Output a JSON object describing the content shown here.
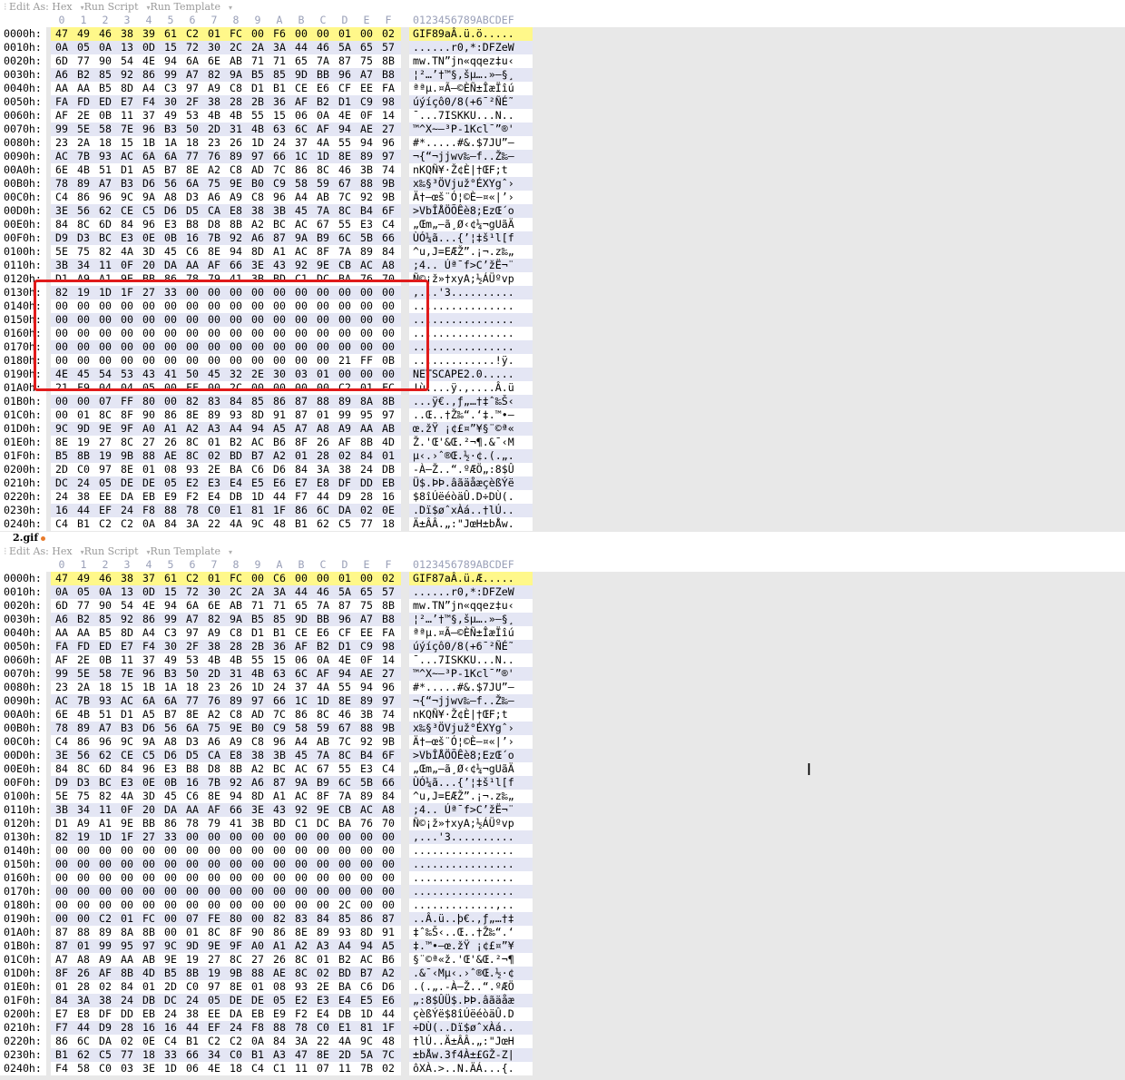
{
  "toolbar": {
    "items": [
      "Edit As: Hex",
      "Run Script",
      "Run Template"
    ]
  },
  "header": {
    "columns": [
      "0",
      "1",
      "2",
      "3",
      "4",
      "5",
      "6",
      "7",
      "8",
      "9",
      "A",
      "B",
      "C",
      "D",
      "E",
      "F"
    ],
    "ascii_header": "0123456789ABCDEF"
  },
  "tab": {
    "label": "2.gif"
  },
  "panes": [
    {
      "rows": [
        {
          "addr": "0000h:",
          "hex": "47 49 46 38 39 61 C2 01 FC 00 F6 00 00 01 00 02",
          "ascii": "GIF89aÂ.ü.ö.....",
          "hl": true
        },
        {
          "addr": "0010h:",
          "hex": "0A 05 0A 13 0D 15 72 30 2C 2A 3A 44 46 5A 65 57",
          "ascii": "......r0,*:DFZeW"
        },
        {
          "addr": "0020h:",
          "hex": "6D 77 90 54 4E 94 6A 6E AB 71 71 65 7A 87 75 8B",
          "ascii": "mw.TN”jn«qqez‡u‹"
        },
        {
          "addr": "0030h:",
          "hex": "A6 B2 85 92 86 99 A7 82 9A B5 85 9D BB 96 A7 B8",
          "ascii": "¦²…’†™§‚šµ….»–§¸"
        },
        {
          "addr": "0040h:",
          "hex": "AA AA B5 8D A4 C3 97 A9 C8 D1 B1 CE E6 CF EE FA",
          "ascii": "ªªµ.¤Ã—©ÈÑ±ÎæÏîú"
        },
        {
          "addr": "0050h:",
          "hex": "FA FD ED E7 F4 30 2F 38 28 2B 36 AF B2 D1 C9 98",
          "ascii": "úýíçô0/8(+6¯²ÑÉ˜"
        },
        {
          "addr": "0060h:",
          "hex": "AF 2E 0B 11 37 49 53 4B 4B 55 15 06 0A 4E 0F 14",
          "ascii": "¯...7ISKKU...N.."
        },
        {
          "addr": "0070h:",
          "hex": "99 5E 58 7E 96 B3 50 2D 31 4B 63 6C AF 94 AE 27",
          "ascii": "™^X~–³P-1Kcl¯”®'"
        },
        {
          "addr": "0080h:",
          "hex": "23 2A 18 15 1B 1A 18 23 26 1D 24 37 4A 55 94 96",
          "ascii": "#*.....#&.$7JU”–"
        },
        {
          "addr": "0090h:",
          "hex": "AC 7B 93 AC 6A 6A 77 76 89 97 66 1C 1D 8E 89 97",
          "ascii": "¬{“¬jjwv‰—f..Ž‰—"
        },
        {
          "addr": "00A0h:",
          "hex": "6E 4B 51 D1 A5 B7 8E A2 C8 AD 7C 86 8C 46 3B 74",
          "ascii": "nKQÑ¥·Ž¢È­|†ŒF;t"
        },
        {
          "addr": "00B0h:",
          "hex": "78 89 A7 B3 D6 56 6A 75 9E B0 C9 58 59 67 88 9B",
          "ascii": "x‰§³ÖVjuž°ÉXYgˆ›"
        },
        {
          "addr": "00C0h:",
          "hex": "C4 86 96 9C 9A A8 D3 A6 A9 C8 96 A4 AB 7C 92 9B",
          "ascii": "Ä†–œš¨Ó¦©È–¤«|’›"
        },
        {
          "addr": "00D0h:",
          "hex": "3E 56 62 CE C5 D6 D5 CA E8 38 3B 45 7A 8C B4 6F",
          "ascii": ">VbÎÅÖÕÊè8;EzŒ´o"
        },
        {
          "addr": "00E0h:",
          "hex": "84 8C 6D 84 96 E3 B8 D8 8B A2 BC AC 67 55 E3 C4",
          "ascii": "„Œm„–ã¸Ø‹¢¼¬gUãÄ"
        },
        {
          "addr": "00F0h:",
          "hex": "D9 D3 BC E3 0E 0B 16 7B 92 A6 87 9A B9 6C 5B 66",
          "ascii": "ÙÓ¼ã...{’¦‡š¹l[f"
        },
        {
          "addr": "0100h:",
          "hex": "5E 75 82 4A 3D 45 C6 8E 94 8D A1 AC 8F 7A 89 84",
          "ascii": "^u‚J=EÆŽ”.¡¬.z‰„"
        },
        {
          "addr": "0110h:",
          "hex": "3B 34 11 0F 20 DA AA AF 66 3E 43 92 9E CB AC A8",
          "ascii": ";4.. Úª¯f>C’žË¬¨"
        },
        {
          "addr": "0120h:",
          "hex": "D1 A9 A1 9E BB 86 78 79 41 3B BD C1 DC BA 76 70",
          "ascii": "Ñ©¡ž»†xyA;½ÁÜºvp"
        },
        {
          "addr": "0130h:",
          "hex": "82 19 1D 1F 27 33 00 00 00 00 00 00 00 00 00 00",
          "ascii": "‚...'3.........."
        },
        {
          "addr": "0140h:",
          "hex": "00 00 00 00 00 00 00 00 00 00 00 00 00 00 00 00",
          "ascii": "................"
        },
        {
          "addr": "0150h:",
          "hex": "00 00 00 00 00 00 00 00 00 00 00 00 00 00 00 00",
          "ascii": "................"
        },
        {
          "addr": "0160h:",
          "hex": "00 00 00 00 00 00 00 00 00 00 00 00 00 00 00 00",
          "ascii": "................"
        },
        {
          "addr": "0170h:",
          "hex": "00 00 00 00 00 00 00 00 00 00 00 00 00 00 00 00",
          "ascii": "................"
        },
        {
          "addr": "0180h:",
          "hex": "00 00 00 00 00 00 00 00 00 00 00 00 00 21 FF 0B",
          "ascii": ".............!ÿ."
        },
        {
          "addr": "0190h:",
          "hex": "4E 45 54 53 43 41 50 45 32 2E 30 03 01 00 00 00",
          "ascii": "NETSCAPE2.0....."
        },
        {
          "addr": "01A0h:",
          "hex": "21 F9 04 04 05 00 FF 00 2C 00 00 00 00 C2 01 FC",
          "ascii": "!ù....ÿ.,....Â.ü"
        },
        {
          "addr": "01B0h:",
          "hex": "00 00 07 FF 80 00 82 83 84 85 86 87 88 89 8A 8B",
          "ascii": "...ÿ€.‚ƒ„…†‡ˆ‰Š‹"
        },
        {
          "addr": "01C0h:",
          "hex": "00 01 8C 8F 90 86 8E 89 93 8D 91 87 01 99 95 97",
          "ascii": "..Œ..†Ž‰“.‘‡.™•—"
        },
        {
          "addr": "01D0h:",
          "hex": "9C 9D 9E 9F A0 A1 A2 A3 A4 94 A5 A7 A8 A9 AA AB",
          "ascii": "œ.žŸ ¡¢£¤”¥§¨©ª«"
        },
        {
          "addr": "01E0h:",
          "hex": "8E 19 27 8C 27 26 8C 01 B2 AC B6 8F 26 AF 8B 4D",
          "ascii": "Ž.'Œ'&Œ.²¬¶.&¯‹M"
        },
        {
          "addr": "01F0h:",
          "hex": "B5 8B 19 9B 88 AE 8C 02 BD B7 A2 01 28 02 84 01",
          "ascii": "µ‹.›ˆ®Œ.½·¢.(.„."
        },
        {
          "addr": "0200h:",
          "hex": "2D C0 97 8E 01 08 93 2E BA C6 D6 84 3A 38 24 DB",
          "ascii": "-À—Ž..“.ºÆÖ„:8$Û"
        },
        {
          "addr": "0210h:",
          "hex": "DC 24 05 DE DE 05 E2 E3 E4 E5 E6 E7 E8 DF DD EB",
          "ascii": "Ü$.ÞÞ.âãäåæçèßÝë"
        },
        {
          "addr": "0220h:",
          "hex": "24 38 EE DA EB E9 F2 E4 DB 1D 44 F7 44 D9 28 16",
          "ascii": "$8îÚëéòäÛ.D÷DÙ(."
        },
        {
          "addr": "0230h:",
          "hex": "16 44 EF 24 F8 88 78 C0 E1 81 1F 86 6C DA 02 0E",
          "ascii": ".Dï$øˆxÀá..†lÚ.."
        },
        {
          "addr": "0240h:",
          "hex": "C4 B1 C2 C2 0A 84 3A 22 4A 9C 48 B1 62 C5 77 18",
          "ascii": "Ä±ÂÂ.„:\"JœH±bÅw."
        }
      ]
    },
    {
      "rows": [
        {
          "addr": "0000h:",
          "hex": "47 49 46 38 37 61 C2 01 FC 00 C6 00 00 01 00 02",
          "ascii": "GIF87aÂ.ü.Æ.....",
          "hl": true
        },
        {
          "addr": "0010h:",
          "hex": "0A 05 0A 13 0D 15 72 30 2C 2A 3A 44 46 5A 65 57",
          "ascii": "......r0,*:DFZeW"
        },
        {
          "addr": "0020h:",
          "hex": "6D 77 90 54 4E 94 6A 6E AB 71 71 65 7A 87 75 8B",
          "ascii": "mw.TN”jn«qqez‡u‹"
        },
        {
          "addr": "0030h:",
          "hex": "A6 B2 85 92 86 99 A7 82 9A B5 85 9D BB 96 A7 B8",
          "ascii": "¦²…’†™§‚šµ….»–§¸"
        },
        {
          "addr": "0040h:",
          "hex": "AA AA B5 8D A4 C3 97 A9 C8 D1 B1 CE E6 CF EE FA",
          "ascii": "ªªµ.¤Ã—©ÈÑ±ÎæÏîú"
        },
        {
          "addr": "0050h:",
          "hex": "FA FD ED E7 F4 30 2F 38 28 2B 36 AF B2 D1 C9 98",
          "ascii": "úýíçô0/8(+6¯²ÑÉ˜"
        },
        {
          "addr": "0060h:",
          "hex": "AF 2E 0B 11 37 49 53 4B 4B 55 15 06 0A 4E 0F 14",
          "ascii": "¯...7ISKKU...N.."
        },
        {
          "addr": "0070h:",
          "hex": "99 5E 58 7E 96 B3 50 2D 31 4B 63 6C AF 94 AE 27",
          "ascii": "™^X~–³P-1Kcl¯”®'"
        },
        {
          "addr": "0080h:",
          "hex": "23 2A 18 15 1B 1A 18 23 26 1D 24 37 4A 55 94 96",
          "ascii": "#*.....#&.$7JU”–"
        },
        {
          "addr": "0090h:",
          "hex": "AC 7B 93 AC 6A 6A 77 76 89 97 66 1C 1D 8E 89 97",
          "ascii": "¬{“¬jjwv‰—f..Ž‰—"
        },
        {
          "addr": "00A0h:",
          "hex": "6E 4B 51 D1 A5 B7 8E A2 C8 AD 7C 86 8C 46 3B 74",
          "ascii": "nKQÑ¥·Ž¢È­|†ŒF;t"
        },
        {
          "addr": "00B0h:",
          "hex": "78 89 A7 B3 D6 56 6A 75 9E B0 C9 58 59 67 88 9B",
          "ascii": "x‰§³ÖVjuž°ÉXYgˆ›"
        },
        {
          "addr": "00C0h:",
          "hex": "C4 86 96 9C 9A A8 D3 A6 A9 C8 96 A4 AB 7C 92 9B",
          "ascii": "Ä†–œš¨Ó¦©È–¤«|’›"
        },
        {
          "addr": "00D0h:",
          "hex": "3E 56 62 CE C5 D6 D5 CA E8 38 3B 45 7A 8C B4 6F",
          "ascii": ">VbÎÅÖÕÊè8;EzŒ´o"
        },
        {
          "addr": "00E0h:",
          "hex": "84 8C 6D 84 96 E3 B8 D8 8B A2 BC AC 67 55 E3 C4",
          "ascii": "„Œm„–ã¸Ø‹¢¼¬gUãÄ"
        },
        {
          "addr": "00F0h:",
          "hex": "D9 D3 BC E3 0E 0B 16 7B 92 A6 87 9A B9 6C 5B 66",
          "ascii": "ÙÓ¼ã...{’¦‡š¹l[f"
        },
        {
          "addr": "0100h:",
          "hex": "5E 75 82 4A 3D 45 C6 8E 94 8D A1 AC 8F 7A 89 84",
          "ascii": "^u‚J=EÆŽ”.¡¬.z‰„"
        },
        {
          "addr": "0110h:",
          "hex": "3B 34 11 0F 20 DA AA AF 66 3E 43 92 9E CB AC A8",
          "ascii": ";4.. Úª¯f>C’žË¬¨"
        },
        {
          "addr": "0120h:",
          "hex": "D1 A9 A1 9E BB 86 78 79 41 3B BD C1 DC BA 76 70",
          "ascii": "Ñ©¡ž»†xyA;½ÁÜºvp"
        },
        {
          "addr": "0130h:",
          "hex": "82 19 1D 1F 27 33 00 00 00 00 00 00 00 00 00 00",
          "ascii": "‚...'3.........."
        },
        {
          "addr": "0140h:",
          "hex": "00 00 00 00 00 00 00 00 00 00 00 00 00 00 00 00",
          "ascii": "................"
        },
        {
          "addr": "0150h:",
          "hex": "00 00 00 00 00 00 00 00 00 00 00 00 00 00 00 00",
          "ascii": "................"
        },
        {
          "addr": "0160h:",
          "hex": "00 00 00 00 00 00 00 00 00 00 00 00 00 00 00 00",
          "ascii": "................"
        },
        {
          "addr": "0170h:",
          "hex": "00 00 00 00 00 00 00 00 00 00 00 00 00 00 00 00",
          "ascii": "................"
        },
        {
          "addr": "0180h:",
          "hex": "00 00 00 00 00 00 00 00 00 00 00 00 00 2C 00 00",
          "ascii": ".............,.."
        },
        {
          "addr": "0190h:",
          "hex": "00 00 C2 01 FC 00 07 FE 80 00 82 83 84 85 86 87",
          "ascii": "..Â.ü..þ€.‚ƒ„…†‡"
        },
        {
          "addr": "01A0h:",
          "hex": "87 88 89 8A 8B 00 01 8C 8F 90 86 8E 89 93 8D 91",
          "ascii": "‡ˆ‰Š‹..Œ..†Ž‰“.‘"
        },
        {
          "addr": "01B0h:",
          "hex": "87 01 99 95 97 9C 9D 9E 9F A0 A1 A2 A3 A4 94 A5",
          "ascii": "‡.™•—œ.žŸ ¡¢£¤”¥"
        },
        {
          "addr": "01C0h:",
          "hex": "A7 A8 A9 AA AB 9E 19 27 8C 27 26 8C 01 B2 AC B6",
          "ascii": "§¨©ª«ž.'Œ'&Œ.²¬¶"
        },
        {
          "addr": "01D0h:",
          "hex": "8F 26 AF 8B 4D B5 8B 19 9B 88 AE 8C 02 BD B7 A2",
          "ascii": ".&¯‹Mµ‹.›ˆ®Œ.½·¢"
        },
        {
          "addr": "01E0h:",
          "hex": "01 28 02 84 01 2D C0 97 8E 01 08 93 2E BA C6 D6",
          "ascii": ".(.„.-À—Ž..“.ºÆÖ"
        },
        {
          "addr": "01F0h:",
          "hex": "84 3A 38 24 DB DC 24 05 DE DE 05 E2 E3 E4 E5 E6",
          "ascii": "„:8$ÛÜ$.ÞÞ.âãäåæ"
        },
        {
          "addr": "0200h:",
          "hex": "E7 E8 DF DD EB 24 38 EE DA EB E9 F2 E4 DB 1D 44",
          "ascii": "çèßÝë$8îÚëéòäÛ.D"
        },
        {
          "addr": "0210h:",
          "hex": "F7 44 D9 28 16 16 44 EF 24 F8 88 78 C0 E1 81 1F",
          "ascii": "÷DÙ(..Dï$øˆxÀá.."
        },
        {
          "addr": "0220h:",
          "hex": "86 6C DA 02 0E C4 B1 C2 C2 0A 84 3A 22 4A 9C 48",
          "ascii": "†lÚ..Ä±ÂÂ.„:\"JœH"
        },
        {
          "addr": "0230h:",
          "hex": "B1 62 C5 77 18 33 66 34 C0 B1 A3 47 8E 2D 5A 7C",
          "ascii": "±bÅw.3f4À±£GŽ-Z|"
        },
        {
          "addr": "0240h:",
          "hex": "F4 58 C0 03 3E 1D 06 4E 18 C4 C1 11 07 11 7B 02",
          "ascii": "ôXÀ.>..N.ÄÁ...{."
        }
      ]
    }
  ]
}
